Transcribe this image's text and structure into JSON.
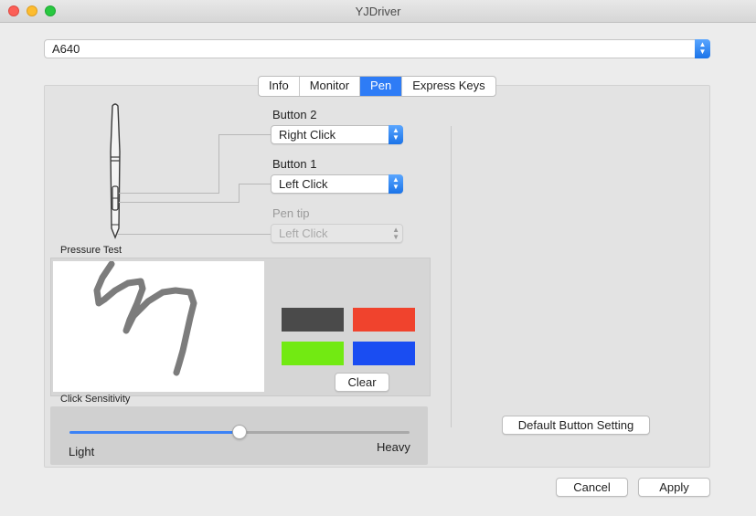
{
  "window": {
    "title": "YJDriver"
  },
  "device": {
    "selected": "A640"
  },
  "tabs": [
    {
      "label": "Info",
      "active": false
    },
    {
      "label": "Monitor",
      "active": false
    },
    {
      "label": "Pen",
      "active": true
    },
    {
      "label": "Express Keys",
      "active": false
    }
  ],
  "pen": {
    "button2": {
      "label": "Button 2",
      "value": "Right Click"
    },
    "button1": {
      "label": "Button 1",
      "value": "Left Click"
    },
    "pen_tip": {
      "label": "Pen tip",
      "value": "Left Click",
      "disabled": true
    }
  },
  "pressure_test": {
    "label": "Pressure Test",
    "clear_label": "Clear",
    "swatches": [
      "#4a4a4a",
      "#f0432d",
      "#72ea12",
      "#1a4df2"
    ]
  },
  "sensitivity": {
    "label": "Click Sensitivity",
    "min_label": "Light",
    "max_label": "Heavy",
    "value": 0.5
  },
  "default_button_label": "Default Button Setting",
  "footer": {
    "cancel_label": "Cancel",
    "apply_label": "Apply"
  },
  "colors": {
    "accent": "#2e7cf6"
  }
}
